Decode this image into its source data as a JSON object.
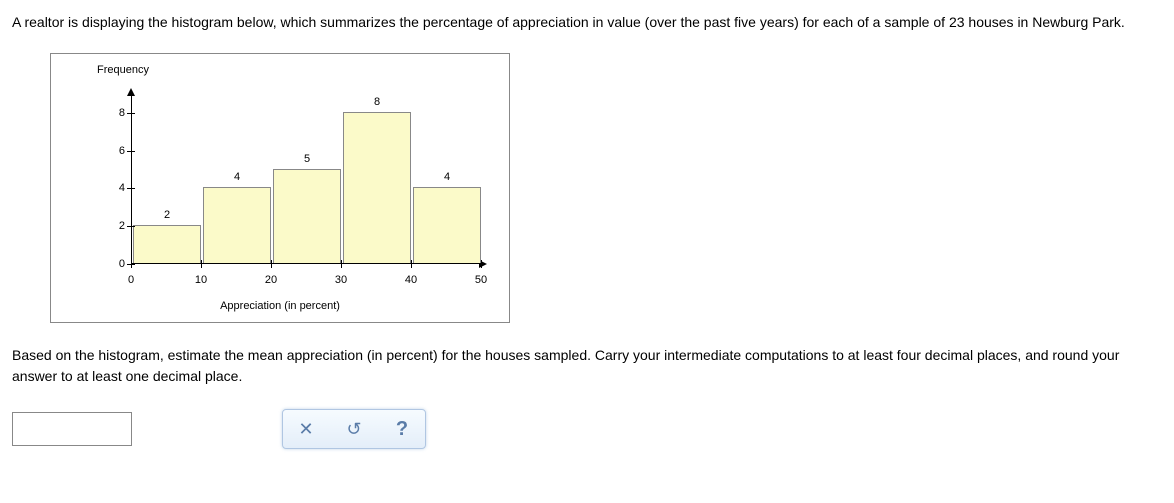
{
  "question": {
    "intro_before": "A realtor is displaying the histogram below, which summarizes the percentage of appreciation in value (over the past five years) for each of a sample of ",
    "sample_n": "23",
    "intro_after": " houses in Newburg Park."
  },
  "chart_data": {
    "type": "bar",
    "title": "",
    "ylabel": "Frequency",
    "xlabel": "Appreciation (in percent)",
    "categories": [
      "0-10",
      "10-20",
      "20-30",
      "30-40",
      "40-50"
    ],
    "values": [
      2,
      4,
      5,
      8,
      4
    ],
    "x_ticks": [
      0,
      10,
      20,
      30,
      40,
      50
    ],
    "y_ticks": [
      0,
      2,
      4,
      6,
      8
    ],
    "ylim": [
      0,
      9
    ]
  },
  "instruction": "Based on the histogram, estimate the mean appreciation (in percent) for the houses sampled. Carry your intermediate computations to at least four decimal places, and round your answer to at least one decimal place.",
  "answer_value": "",
  "buttons": {
    "clear": "✕",
    "reset": "↺",
    "help": "?"
  }
}
